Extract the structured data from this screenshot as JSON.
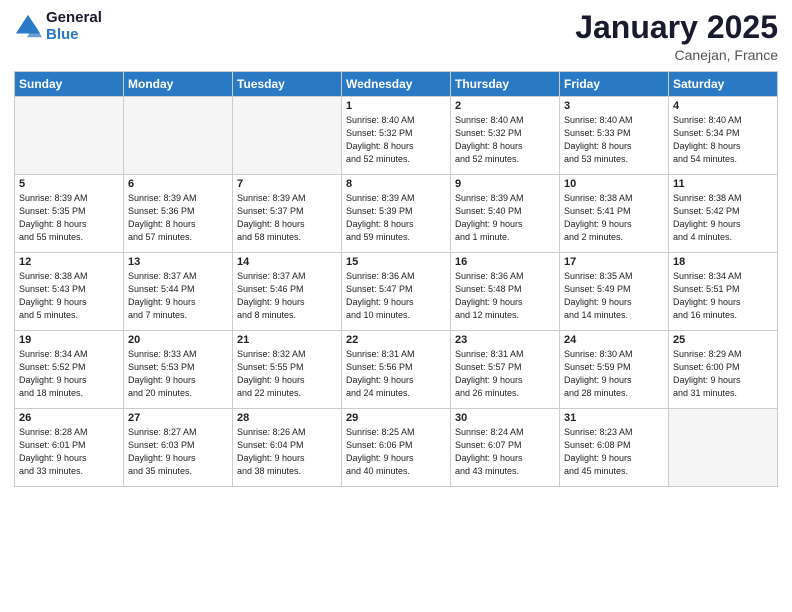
{
  "header": {
    "logo_line1": "General",
    "logo_line2": "Blue",
    "month": "January 2025",
    "location": "Canejan, France"
  },
  "weekdays": [
    "Sunday",
    "Monday",
    "Tuesday",
    "Wednesday",
    "Thursday",
    "Friday",
    "Saturday"
  ],
  "weeks": [
    [
      {
        "day": "",
        "info": ""
      },
      {
        "day": "",
        "info": ""
      },
      {
        "day": "",
        "info": ""
      },
      {
        "day": "1",
        "info": "Sunrise: 8:40 AM\nSunset: 5:32 PM\nDaylight: 8 hours\nand 52 minutes."
      },
      {
        "day": "2",
        "info": "Sunrise: 8:40 AM\nSunset: 5:32 PM\nDaylight: 8 hours\nand 52 minutes."
      },
      {
        "day": "3",
        "info": "Sunrise: 8:40 AM\nSunset: 5:33 PM\nDaylight: 8 hours\nand 53 minutes."
      },
      {
        "day": "4",
        "info": "Sunrise: 8:40 AM\nSunset: 5:34 PM\nDaylight: 8 hours\nand 54 minutes."
      }
    ],
    [
      {
        "day": "5",
        "info": "Sunrise: 8:39 AM\nSunset: 5:35 PM\nDaylight: 8 hours\nand 55 minutes."
      },
      {
        "day": "6",
        "info": "Sunrise: 8:39 AM\nSunset: 5:36 PM\nDaylight: 8 hours\nand 57 minutes."
      },
      {
        "day": "7",
        "info": "Sunrise: 8:39 AM\nSunset: 5:37 PM\nDaylight: 8 hours\nand 58 minutes."
      },
      {
        "day": "8",
        "info": "Sunrise: 8:39 AM\nSunset: 5:39 PM\nDaylight: 8 hours\nand 59 minutes."
      },
      {
        "day": "9",
        "info": "Sunrise: 8:39 AM\nSunset: 5:40 PM\nDaylight: 9 hours\nand 1 minute."
      },
      {
        "day": "10",
        "info": "Sunrise: 8:38 AM\nSunset: 5:41 PM\nDaylight: 9 hours\nand 2 minutes."
      },
      {
        "day": "11",
        "info": "Sunrise: 8:38 AM\nSunset: 5:42 PM\nDaylight: 9 hours\nand 4 minutes."
      }
    ],
    [
      {
        "day": "12",
        "info": "Sunrise: 8:38 AM\nSunset: 5:43 PM\nDaylight: 9 hours\nand 5 minutes."
      },
      {
        "day": "13",
        "info": "Sunrise: 8:37 AM\nSunset: 5:44 PM\nDaylight: 9 hours\nand 7 minutes."
      },
      {
        "day": "14",
        "info": "Sunrise: 8:37 AM\nSunset: 5:46 PM\nDaylight: 9 hours\nand 8 minutes."
      },
      {
        "day": "15",
        "info": "Sunrise: 8:36 AM\nSunset: 5:47 PM\nDaylight: 9 hours\nand 10 minutes."
      },
      {
        "day": "16",
        "info": "Sunrise: 8:36 AM\nSunset: 5:48 PM\nDaylight: 9 hours\nand 12 minutes."
      },
      {
        "day": "17",
        "info": "Sunrise: 8:35 AM\nSunset: 5:49 PM\nDaylight: 9 hours\nand 14 minutes."
      },
      {
        "day": "18",
        "info": "Sunrise: 8:34 AM\nSunset: 5:51 PM\nDaylight: 9 hours\nand 16 minutes."
      }
    ],
    [
      {
        "day": "19",
        "info": "Sunrise: 8:34 AM\nSunset: 5:52 PM\nDaylight: 9 hours\nand 18 minutes."
      },
      {
        "day": "20",
        "info": "Sunrise: 8:33 AM\nSunset: 5:53 PM\nDaylight: 9 hours\nand 20 minutes."
      },
      {
        "day": "21",
        "info": "Sunrise: 8:32 AM\nSunset: 5:55 PM\nDaylight: 9 hours\nand 22 minutes."
      },
      {
        "day": "22",
        "info": "Sunrise: 8:31 AM\nSunset: 5:56 PM\nDaylight: 9 hours\nand 24 minutes."
      },
      {
        "day": "23",
        "info": "Sunrise: 8:31 AM\nSunset: 5:57 PM\nDaylight: 9 hours\nand 26 minutes."
      },
      {
        "day": "24",
        "info": "Sunrise: 8:30 AM\nSunset: 5:59 PM\nDaylight: 9 hours\nand 28 minutes."
      },
      {
        "day": "25",
        "info": "Sunrise: 8:29 AM\nSunset: 6:00 PM\nDaylight: 9 hours\nand 31 minutes."
      }
    ],
    [
      {
        "day": "26",
        "info": "Sunrise: 8:28 AM\nSunset: 6:01 PM\nDaylight: 9 hours\nand 33 minutes."
      },
      {
        "day": "27",
        "info": "Sunrise: 8:27 AM\nSunset: 6:03 PM\nDaylight: 9 hours\nand 35 minutes."
      },
      {
        "day": "28",
        "info": "Sunrise: 8:26 AM\nSunset: 6:04 PM\nDaylight: 9 hours\nand 38 minutes."
      },
      {
        "day": "29",
        "info": "Sunrise: 8:25 AM\nSunset: 6:06 PM\nDaylight: 9 hours\nand 40 minutes."
      },
      {
        "day": "30",
        "info": "Sunrise: 8:24 AM\nSunset: 6:07 PM\nDaylight: 9 hours\nand 43 minutes."
      },
      {
        "day": "31",
        "info": "Sunrise: 8:23 AM\nSunset: 6:08 PM\nDaylight: 9 hours\nand 45 minutes."
      },
      {
        "day": "",
        "info": ""
      }
    ]
  ]
}
